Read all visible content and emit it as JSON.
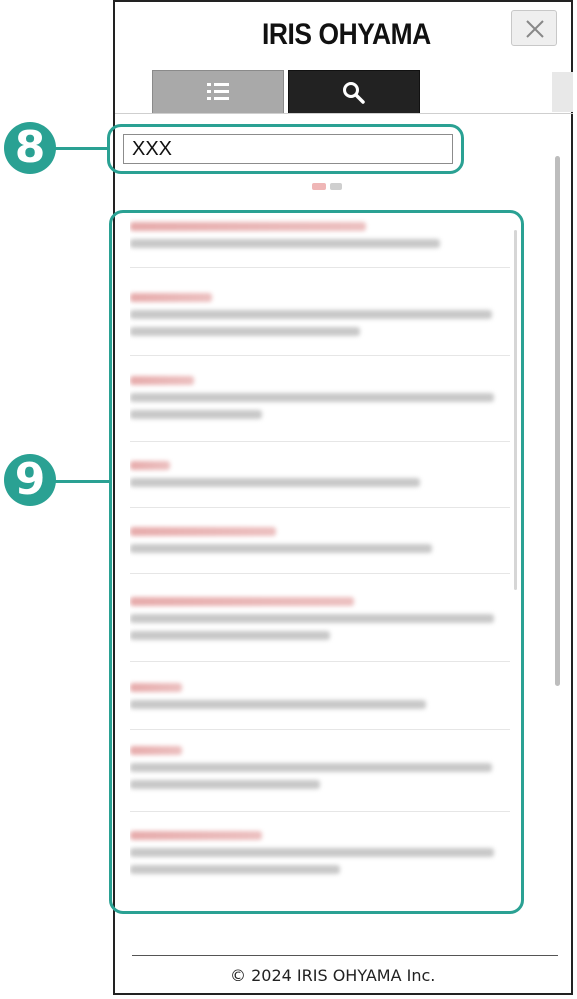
{
  "header": {
    "logo_text": "IRIS OHYAMA",
    "close_icon": "close-icon"
  },
  "tabs": [
    {
      "name": "list",
      "icon": "list-icon",
      "active": false
    },
    {
      "name": "search",
      "icon": "search-icon",
      "active": true
    }
  ],
  "search": {
    "value": "XXX"
  },
  "callouts": {
    "search_field_number": "8",
    "results_number": "9"
  },
  "footer": {
    "copyright": "© 2024 IRIS OHYAMA Inc."
  },
  "colors": {
    "callout": "#2aa193",
    "active_tab": "#222222",
    "inactive_tab": "#a9a9a9",
    "result_title": "#e4a2a2"
  }
}
